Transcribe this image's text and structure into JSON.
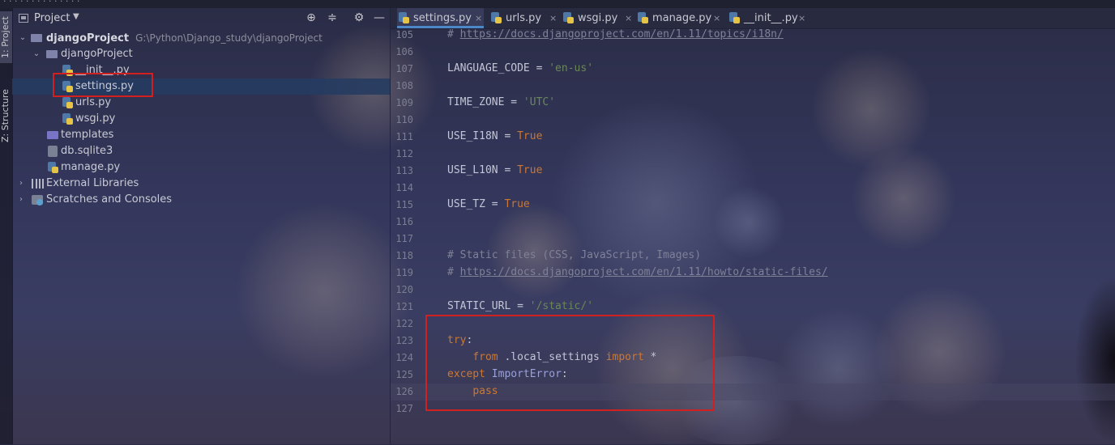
{
  "stripe": {
    "project_label": "1: Project",
    "structure_label": "Z: Structure"
  },
  "project_pane": {
    "title": "Project"
  },
  "tree": {
    "root": {
      "name": "djangoProject",
      "path": "G:\\Python\\Django_study\\djangoProject"
    },
    "pkg": {
      "name": "djangoProject"
    },
    "files": [
      "__init__.py",
      "settings.py",
      "urls.py",
      "wsgi.py"
    ],
    "templates": "templates",
    "db": "db.sqlite3",
    "manage": "manage.py",
    "external": "External Libraries",
    "scratches": "Scratches and Consoles"
  },
  "tabs": [
    {
      "label": "settings.py",
      "active": true
    },
    {
      "label": "urls.py"
    },
    {
      "label": "wsgi.py"
    },
    {
      "label": "manage.py"
    },
    {
      "label": "__init__.py"
    }
  ],
  "gutter": [
    "105",
    "106",
    "107",
    "108",
    "109",
    "110",
    "111",
    "112",
    "113",
    "114",
    "115",
    "116",
    "117",
    "118",
    "119",
    "120",
    "121",
    "122",
    "123",
    "124",
    "125",
    "126",
    "127"
  ],
  "code": {
    "l0": "# ",
    "l0url": "https://docs.djangoproject.com/en/1.11/topics/i18n/",
    "l2a": "LANGUAGE_CODE = ",
    "l2b": "'en-us'",
    "l4a": "TIME_ZONE = ",
    "l4b": "'UTC'",
    "l6a": "USE_I18N = ",
    "l6b": "True",
    "l8a": "USE_L10N = ",
    "l8b": "True",
    "l10a": "USE_TZ = ",
    "l10b": "True",
    "l13": "# Static files (CSS, JavaScript, Images)",
    "l14a": "# ",
    "l14url": "https://docs.djangoproject.com/en/1.11/howto/static-files/",
    "l16a": "STATIC_URL = ",
    "l16b": "'/static/'",
    "l18a": "try",
    "l18b": ":",
    "l19a": "    ",
    "l19b": "from",
    "l19c": " .local_settings ",
    "l19d": "import",
    "l19e": " *",
    "l20a": "except ",
    "l20b": "ImportError",
    "l20c": ":",
    "l21a": "    ",
    "l21b": "pass"
  }
}
